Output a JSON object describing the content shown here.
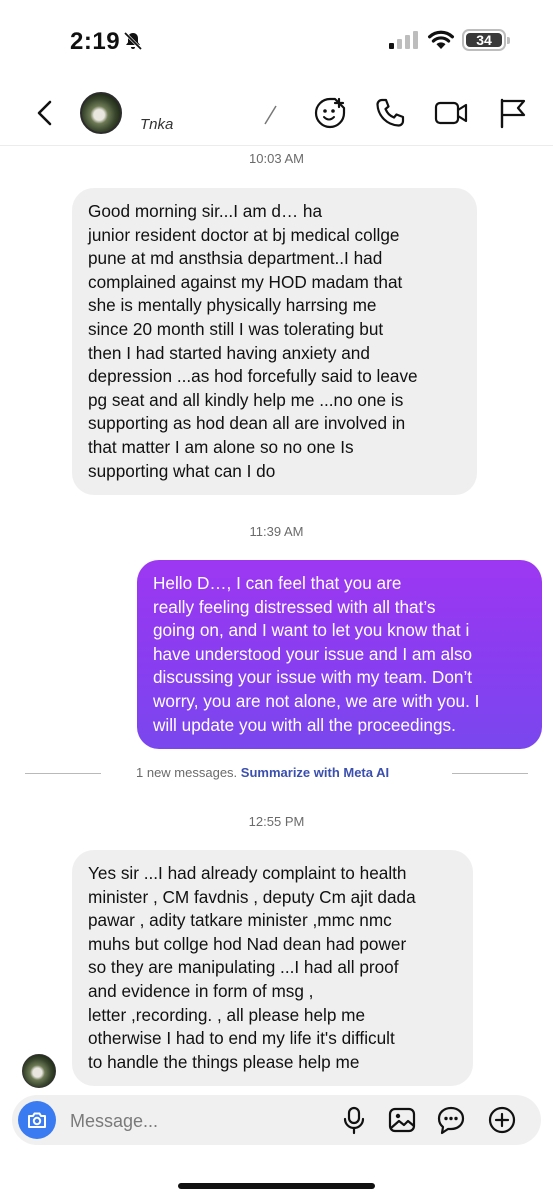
{
  "status_bar": {
    "time": "2:19",
    "battery": "34"
  },
  "header": {
    "contact_name": "Tnka"
  },
  "messages": [
    {
      "timestamp": "10:03 AM",
      "lines": [
        "Good morning sir...I am d… ha",
        "junior resident doctor at bj medical collge",
        "pune at md ansthsia department..I had",
        "complained against my HOD  madam that",
        "she is mentally physically harrsing  me",
        "since 20 month still I was tolerating but",
        "then I had started having anxiety  and",
        "depression ...as hod forcefully said to leave",
        "pg seat and all kindly help me ...no one is",
        "supporting as hod dean all are involved in",
        "that matter I am alone so no one Is",
        "supporting what can I do"
      ]
    },
    {
      "timestamp": "11:39 AM",
      "lines": [
        "Hello D…, I can feel that you are",
        "really feeling distressed with all that’s",
        "going on, and I want to let you know that i",
        "have understood your issue and I am also",
        "discussing your issue with my team. Don’t",
        "worry, you are not alone, we are with you.  I",
        "will update you with all the proceedings."
      ]
    },
    {
      "timestamp": "12:55 PM",
      "lines": [
        "Yes sir ...I had already complaint to health",
        "minister , CM favdnis , deputy Cm ajit dada",
        "pawar , adity tatkare minister ,mmc nmc",
        "muhs but collge hod Nad dean had power",
        "so they are manipulating ...I had all proof",
        "and evidence in form of msg ,",
        "letter ,recording.  , all please help me",
        "otherwise I had to end my life it's difficult",
        "to handle the things please help me"
      ]
    }
  ],
  "divider": {
    "text": "1 new messages.",
    "link": "Summarize with Meta AI"
  },
  "composer": {
    "placeholder": "Message..."
  },
  "colors": {
    "accent_purple": "#8a3df0",
    "camera_blue": "#3a7bf2",
    "incoming_bubble": "#efefef"
  },
  "icons": [
    "bell-slash-icon",
    "signal-icon",
    "wifi-icon",
    "back-icon",
    "chevron-right-icon",
    "sticker-icon",
    "phone-icon",
    "video-icon",
    "flag-icon",
    "camera-icon",
    "mic-icon",
    "gallery-icon",
    "chat-bubble-icon",
    "plus-icon"
  ]
}
